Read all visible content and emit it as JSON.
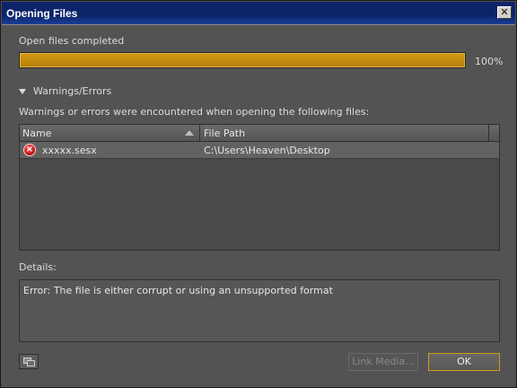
{
  "window": {
    "title": "Opening Files",
    "close_glyph": "✕"
  },
  "progress": {
    "status": "Open files completed",
    "value": 1.0,
    "percent_label": "100%",
    "color": "#c08a0e"
  },
  "warnings": {
    "toggle_label": "Warnings/Errors",
    "description": "Warnings or errors were encountered when opening the following files:",
    "columns": {
      "name": "Name",
      "path": "File Path"
    },
    "rows": [
      {
        "icon": "error-icon",
        "name": "xxxxx.sesx",
        "path": "C:\\Users\\Heaven\\Desktop"
      }
    ]
  },
  "details": {
    "label": "Details:",
    "text": "Error: The file is either corrupt or using an unsupported format"
  },
  "footer": {
    "link_media_label": "Link Media...",
    "ok_label": "OK"
  }
}
